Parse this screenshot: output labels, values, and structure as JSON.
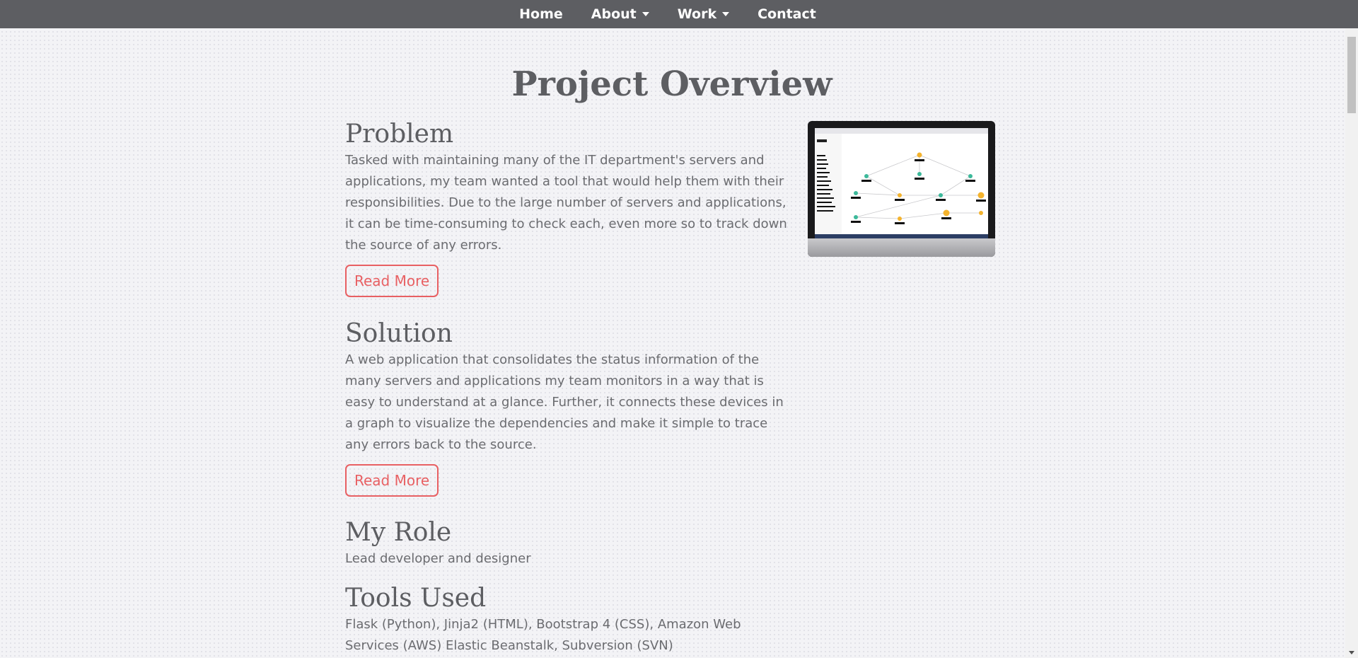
{
  "nav": {
    "items": [
      {
        "label": "Home",
        "has_dropdown": false
      },
      {
        "label": "About",
        "has_dropdown": true
      },
      {
        "label": "Work",
        "has_dropdown": true
      },
      {
        "label": "Contact",
        "has_dropdown": false
      }
    ]
  },
  "page": {
    "title": "Project Overview"
  },
  "sections": {
    "problem": {
      "heading": "Problem",
      "text": "Tasked with maintaining many of the IT department's servers and applications, my team wanted a tool that would help them with their responsibilities. Due to the large number of servers and applications, it can be time-consuming to check each, even more so to track down the source of any errors.",
      "button": "Read More"
    },
    "solution": {
      "heading": "Solution",
      "text": "A web application that consolidates the status information of the many servers and applications my team monitors in a way that is easy to understand at a glance. Further, it connects these devices in a graph to visualize the dependencies and make it simple to trace any errors back to the source.",
      "button": "Read More"
    },
    "role": {
      "heading": "My Role",
      "text": "Lead developer and designer"
    },
    "tools": {
      "heading": "Tools Used",
      "text": "Flask (Python), Jinja2 (HTML), Bootstrap 4 (CSS), Amazon Web Services (AWS) Elastic Beanstalk, Subversion (SVN)"
    }
  },
  "colors": {
    "nav_bg": "#5d5e62",
    "accent": "#e86063",
    "text": "#5d5e62"
  },
  "icons": {
    "dropdown": "caret-down-icon"
  }
}
